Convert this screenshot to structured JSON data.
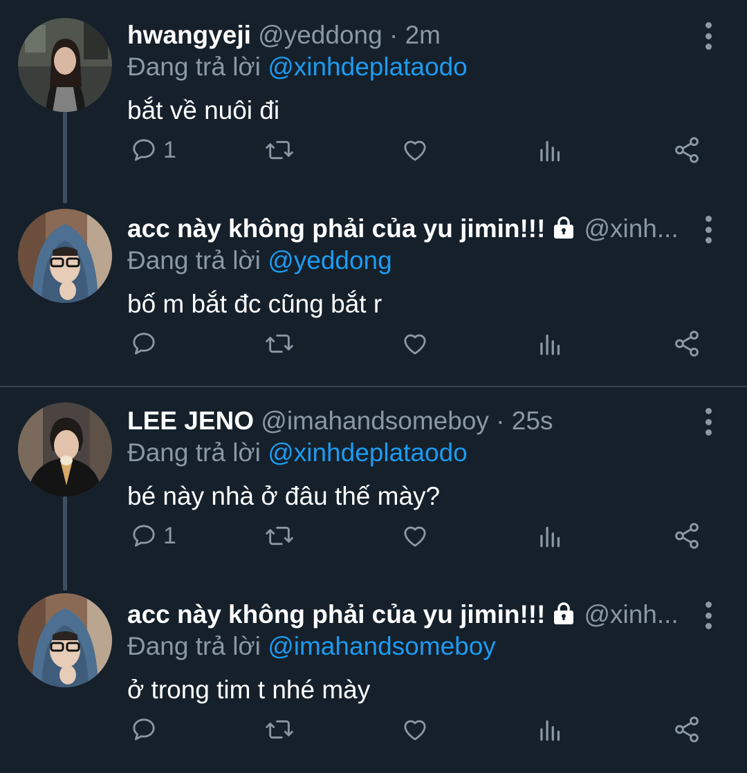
{
  "colors": {
    "background": "#15202b",
    "secondary_text": "#8b98a5",
    "link": "#1d9bf0",
    "thread_line": "#3d4f61",
    "divider": "#38444d"
  },
  "tweets": [
    {
      "name": "hwangyeji",
      "handle": "@yeddong · 2m",
      "locked": false,
      "reply_prefix": "Đang trả lời",
      "reply_target": "@xinhdeplataodo",
      "text": "bắt về nuôi đi",
      "reply_count": "1",
      "avatar_icon": "profile-photo"
    },
    {
      "name": "acc này không phải của yu jimin!!!",
      "handle": "@xinh...",
      "locked": true,
      "reply_prefix": "Đang trả lời",
      "reply_target": "@yeddong",
      "text": "bố m bắt đc cũng bắt r",
      "reply_count": "",
      "avatar_icon": "profile-photo"
    },
    {
      "name": "LEE JENO",
      "handle": "@imahandsomeboy · 25s",
      "locked": false,
      "reply_prefix": "Đang trả lời",
      "reply_target": "@xinhdeplataodo",
      "text": "bé này nhà ở đâu thế mày?",
      "reply_count": "1",
      "avatar_icon": "profile-photo"
    },
    {
      "name": "acc này không phải của yu jimin!!!",
      "handle": "@xinh...",
      "locked": true,
      "reply_prefix": "Đang trả lời",
      "reply_target": "@imahandsomeboy",
      "text": "ở trong tim t nhé mày",
      "reply_count": "",
      "avatar_icon": "profile-photo"
    }
  ],
  "action_icons": [
    "reply-icon",
    "retweet-icon",
    "like-icon",
    "analytics-icon",
    "share-icon"
  ]
}
